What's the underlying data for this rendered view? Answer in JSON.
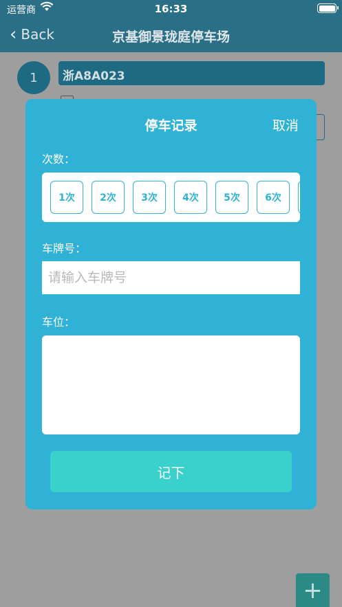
{
  "status_bar": {
    "carrier": "运营商",
    "time": "16:33"
  },
  "nav": {
    "back_label": "Back",
    "title": "京基御景珑庭停车场"
  },
  "background": {
    "index": "1",
    "plate": "浙A8A023"
  },
  "modal": {
    "title": "停车记录",
    "cancel_label": "取消",
    "count_label": "次数：",
    "count_options": [
      "1次",
      "2次",
      "3次",
      "4次",
      "5次",
      "6次"
    ],
    "plate_label": "车牌号：",
    "plate_placeholder": "请输入车牌号",
    "plate_value": "",
    "spot_label": "车位：",
    "spot_value": "",
    "submit_label": "记下"
  },
  "fab_label": "+",
  "colors": {
    "modal_bg": "#2fb2d6",
    "submit_bg": "#3ad0cc",
    "nav_bg": "#2a6f86"
  }
}
